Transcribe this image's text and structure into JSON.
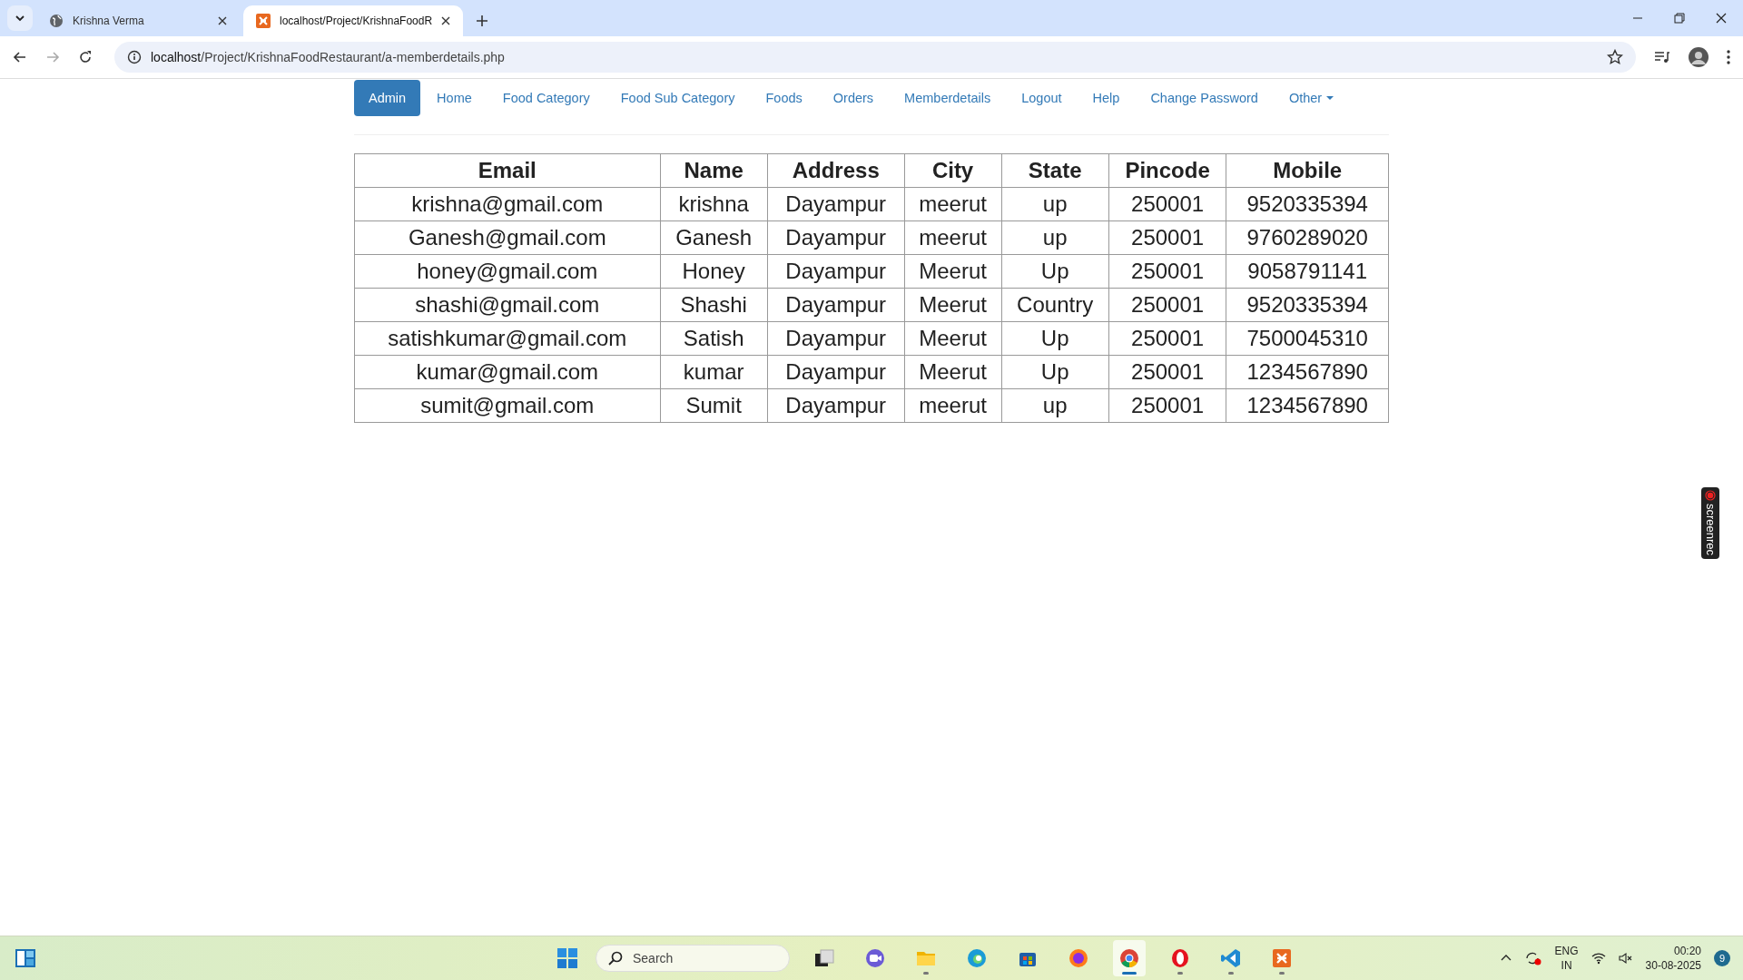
{
  "browser": {
    "tabs": [
      {
        "title": "Krishna Verma",
        "kind": "globe",
        "selected": false
      },
      {
        "title": "localhost/Project/KrishnaFoodR",
        "kind": "xampp",
        "selected": true
      }
    ],
    "address": {
      "host": "localhost",
      "path": "/Project/KrishnaFoodRestaurant/a-memberdetails.php"
    }
  },
  "nav": [
    {
      "label": "Admin",
      "selected": true,
      "dropdown": false
    },
    {
      "label": "Home",
      "selected": false,
      "dropdown": false
    },
    {
      "label": "Food Category",
      "selected": false,
      "dropdown": false
    },
    {
      "label": "Food Sub Category",
      "selected": false,
      "dropdown": false
    },
    {
      "label": "Foods",
      "selected": false,
      "dropdown": false
    },
    {
      "label": "Orders",
      "selected": false,
      "dropdown": false
    },
    {
      "label": "Memberdetails",
      "selected": false,
      "dropdown": false
    },
    {
      "label": "Logout",
      "selected": false,
      "dropdown": false
    },
    {
      "label": "Help",
      "selected": false,
      "dropdown": false
    },
    {
      "label": "Change Password",
      "selected": false,
      "dropdown": false
    },
    {
      "label": "Other",
      "selected": false,
      "dropdown": true
    }
  ],
  "table": {
    "columns": [
      "Email",
      "Name",
      "Address",
      "City",
      "State",
      "Pincode",
      "Mobile"
    ],
    "rows": [
      [
        "krishna@gmail.com",
        "krishna",
        "Dayampur",
        "meerut",
        "up",
        "250001",
        "9520335394"
      ],
      [
        "Ganesh@gmail.com",
        "Ganesh",
        "Dayampur",
        "meerut",
        "up",
        "250001",
        "9760289020"
      ],
      [
        "honey@gmail.com",
        "Honey",
        "Dayampur",
        "Meerut",
        "Up",
        "250001",
        "9058791141"
      ],
      [
        "shashi@gmail.com",
        "Shashi",
        "Dayampur",
        "Meerut",
        "Country",
        "250001",
        "9520335394"
      ],
      [
        "satishkumar@gmail.com",
        "Satish",
        "Dayampur",
        "Meerut",
        "Up",
        "250001",
        "7500045310"
      ],
      [
        "kumar@gmail.com",
        "kumar",
        "Dayampur",
        "Meerut",
        "Up",
        "250001",
        "1234567890"
      ],
      [
        "sumit@gmail.com",
        "Sumit",
        "Dayampur",
        "meerut",
        "up",
        "250001",
        "1234567890"
      ]
    ]
  },
  "recorder_badge": "screenrec",
  "taskbar": {
    "search_placeholder": "Search",
    "apps": [
      {
        "kind": "taskview",
        "running": false,
        "selected": false
      },
      {
        "kind": "meet",
        "running": false,
        "selected": false
      },
      {
        "kind": "folder",
        "running": true,
        "selected": false
      },
      {
        "kind": "edge",
        "running": false,
        "selected": false
      },
      {
        "kind": "store",
        "running": false,
        "selected": false
      },
      {
        "kind": "firefox",
        "running": false,
        "selected": false
      },
      {
        "kind": "chrome",
        "running": true,
        "selected": true
      },
      {
        "kind": "opera",
        "running": true,
        "selected": false
      },
      {
        "kind": "vscode",
        "running": true,
        "selected": false
      },
      {
        "kind": "xampp",
        "running": true,
        "selected": false
      }
    ],
    "language": [
      "ENG",
      "IN"
    ],
    "time": "00:20",
    "date": "30-08-2025",
    "notifications": "9"
  }
}
